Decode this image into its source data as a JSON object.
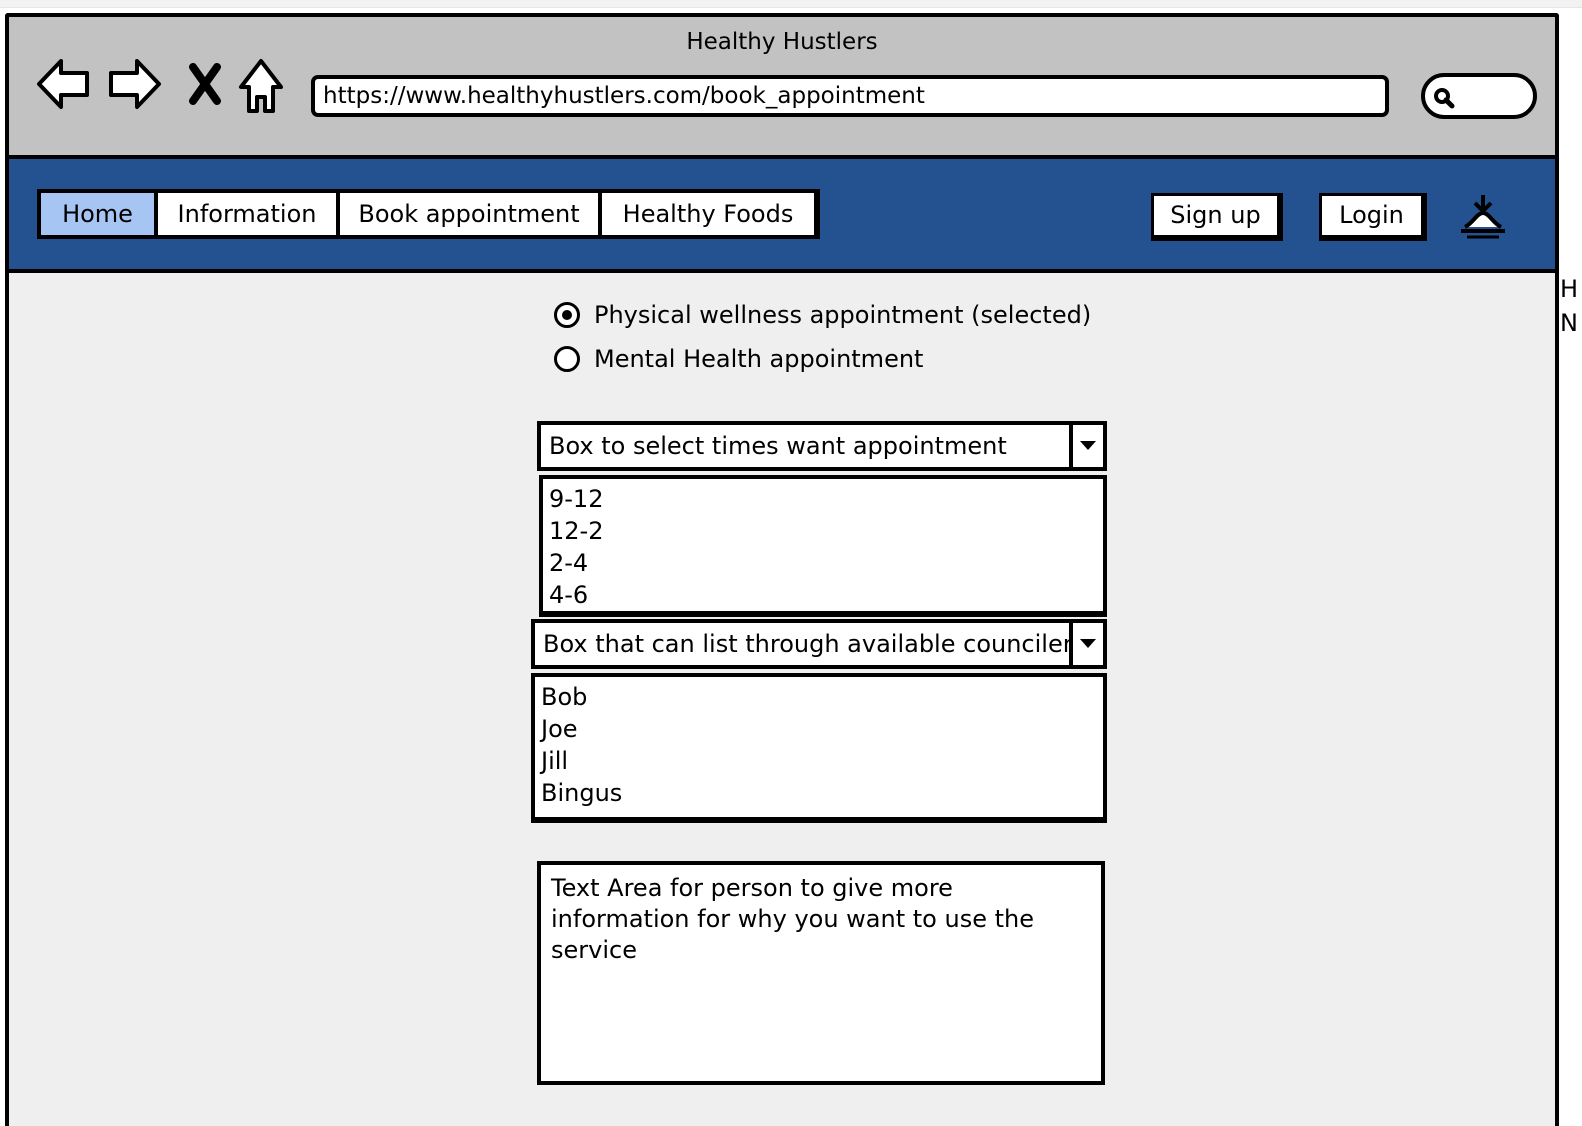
{
  "window": {
    "title": "Healthy Hustlers"
  },
  "browser": {
    "url": "https://www.healthyhustlers.com/book_appointment",
    "icons": [
      "back-arrow-icon",
      "forward-arrow-icon",
      "stop-x-icon",
      "home-icon",
      "search-icon"
    ]
  },
  "nav": {
    "tabs": [
      {
        "label": "Home",
        "active": true
      },
      {
        "label": "Information",
        "active": false
      },
      {
        "label": "Book appointment",
        "active": false
      },
      {
        "label": "Healthy Foods",
        "active": false
      }
    ],
    "signup_label": "Sign up",
    "login_label": "Login",
    "user_icon": "user-icon",
    "bar_color": "#245190",
    "active_tab_color": "#a7c5f2"
  },
  "appointment_type": {
    "options": [
      {
        "label": "Physical wellness appointment (selected)",
        "selected": true
      },
      {
        "label": "Mental Health appointment",
        "selected": false
      }
    ]
  },
  "times": {
    "label": "Box to select times want appointment",
    "options": [
      "9-12",
      "12-2",
      "2-4",
      "4-6"
    ]
  },
  "councilors": {
    "label": "Box that can list through available councilers",
    "options": [
      "Bob",
      "Joe",
      "Jill",
      "Bingus"
    ]
  },
  "info_text": {
    "value": "Text Area for person to give more information for why you want to use the service"
  },
  "edge_clip": {
    "line1": "H",
    "line2": "N"
  }
}
